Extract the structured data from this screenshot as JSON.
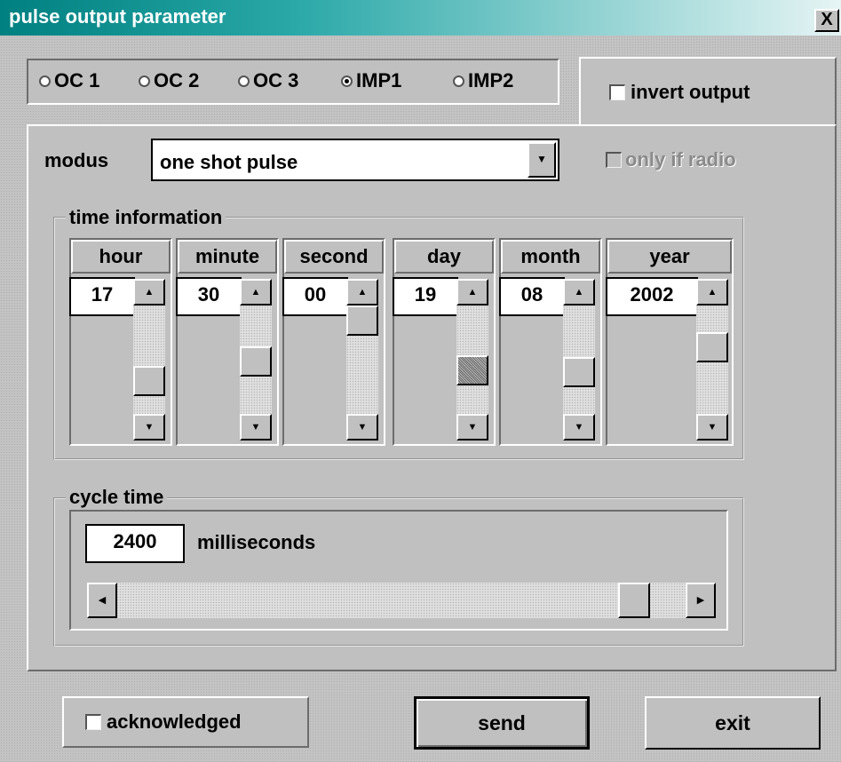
{
  "window": {
    "title": "pulse output parameter",
    "close_glyph": "X"
  },
  "outputs": {
    "options": [
      "OC 1",
      "OC 2",
      "OC 3",
      "IMP1",
      "IMP2"
    ],
    "selected": "IMP1"
  },
  "invert_output": {
    "label": "invert output",
    "checked": false
  },
  "modus": {
    "label": "modus",
    "value": "one shot pulse"
  },
  "only_if_radio": {
    "label": "only if radio",
    "checked": false,
    "enabled": false
  },
  "time_information": {
    "title": "time information",
    "fields": [
      {
        "label": "hour",
        "value": "17"
      },
      {
        "label": "minute",
        "value": "30"
      },
      {
        "label": "second",
        "value": "00"
      },
      {
        "label": "day",
        "value": "19"
      },
      {
        "label": "month",
        "value": "08"
      },
      {
        "label": "year",
        "value": "2002"
      }
    ]
  },
  "cycle_time": {
    "title": "cycle time",
    "value": "2400",
    "unit": "milliseconds"
  },
  "acknowledged": {
    "label": "acknowledged",
    "checked": false
  },
  "buttons": {
    "send": "send",
    "exit": "exit"
  },
  "icons": {
    "scroll_up": "scroll-up-arrow-icon",
    "scroll_down": "scroll-down-arrow-icon",
    "scroll_left": "scroll-left-arrow-icon",
    "scroll_right": "scroll-right-arrow-icon",
    "dropdown": "dropdown-arrow-icon",
    "close": "close-icon"
  }
}
